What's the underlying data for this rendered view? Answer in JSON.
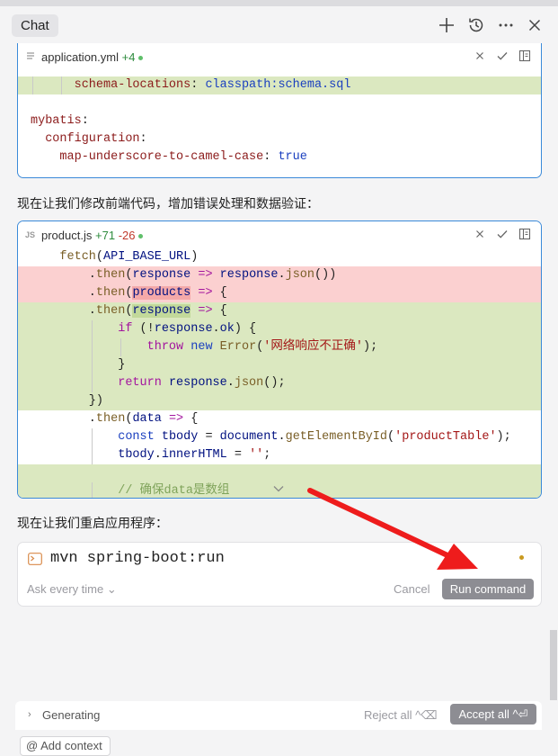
{
  "header": {
    "tab_label": "Chat",
    "icons": [
      "plus-icon",
      "history-icon",
      "more-icon",
      "close-icon"
    ]
  },
  "card1": {
    "filename": "application.yml",
    "stat_add": "+4",
    "lines": [
      {
        "t": "add",
        "parts": [
          {
            "c": "k-pl",
            "s": "      "
          },
          {
            "c": "k-key",
            "s": "schema-locations"
          },
          {
            "c": "k-pl",
            "s": ": "
          },
          {
            "c": "k-val",
            "s": "classpath:schema.sql"
          }
        ]
      },
      {
        "t": "blank",
        "parts": []
      },
      {
        "t": "plain",
        "parts": [
          {
            "c": "k-key",
            "s": "mybatis"
          },
          {
            "c": "k-pl",
            "s": ":"
          }
        ]
      },
      {
        "t": "plain",
        "parts": [
          {
            "c": "k-pl",
            "s": "  "
          },
          {
            "c": "k-key",
            "s": "configuration"
          },
          {
            "c": "k-pl",
            "s": ":"
          }
        ]
      },
      {
        "t": "plain",
        "parts": [
          {
            "c": "k-pl",
            "s": "    "
          },
          {
            "c": "k-key",
            "s": "map-underscore-to-camel-case"
          },
          {
            "c": "k-pl",
            "s": ": "
          },
          {
            "c": "k-val",
            "s": "true"
          }
        ]
      }
    ]
  },
  "para1": "现在让我们修改前端代码，增加错误处理和数据验证：",
  "card2": {
    "filename": "product.js",
    "stat_add": "+71",
    "stat_del": "-26",
    "lines": [
      {
        "t": "plain",
        "parts": [
          {
            "c": "k-pl",
            "s": "    "
          },
          {
            "c": "k-fn",
            "s": "fetch"
          },
          {
            "c": "k-pl",
            "s": "("
          },
          {
            "c": "k-id",
            "s": "API_BASE_URL"
          },
          {
            "c": "k-pl",
            "s": ")"
          }
        ]
      },
      {
        "t": "del",
        "parts": [
          {
            "c": "k-pl",
            "s": "        ."
          },
          {
            "c": "k-fn",
            "s": "then"
          },
          {
            "c": "k-pl",
            "s": "("
          },
          {
            "c": "k-id",
            "s": "response"
          },
          {
            "c": "k-pl",
            "s": " "
          },
          {
            "c": "k-kw",
            "s": "=>"
          },
          {
            "c": "k-pl",
            "s": " "
          },
          {
            "c": "k-id",
            "s": "response"
          },
          {
            "c": "k-pl",
            "s": "."
          },
          {
            "c": "k-fn",
            "s": "json"
          },
          {
            "c": "k-pl",
            "s": "())"
          }
        ]
      },
      {
        "t": "del",
        "parts": [
          {
            "c": "k-pl",
            "s": "        ."
          },
          {
            "c": "k-fn",
            "s": "then"
          },
          {
            "c": "k-pl",
            "s": "("
          },
          {
            "c": "k-id hl-del",
            "s": "products"
          },
          {
            "c": "k-pl",
            "s": " "
          },
          {
            "c": "k-kw",
            "s": "=>"
          },
          {
            "c": "k-pl",
            "s": " {"
          }
        ]
      },
      {
        "t": "add",
        "parts": [
          {
            "c": "k-pl",
            "s": "        ."
          },
          {
            "c": "k-fn",
            "s": "then"
          },
          {
            "c": "k-pl",
            "s": "("
          },
          {
            "c": "k-id hl-add",
            "s": "response"
          },
          {
            "c": "k-pl",
            "s": " "
          },
          {
            "c": "k-kw",
            "s": "=>"
          },
          {
            "c": "k-pl",
            "s": " {"
          }
        ]
      },
      {
        "t": "add",
        "parts": [
          {
            "c": "k-pl",
            "s": "            "
          },
          {
            "c": "k-kw",
            "s": "if"
          },
          {
            "c": "k-pl",
            "s": " (!"
          },
          {
            "c": "k-id",
            "s": "response"
          },
          {
            "c": "k-pl",
            "s": "."
          },
          {
            "c": "k-id",
            "s": "ok"
          },
          {
            "c": "k-pl",
            "s": ") {"
          }
        ]
      },
      {
        "t": "add",
        "parts": [
          {
            "c": "k-pl",
            "s": "                "
          },
          {
            "c": "k-kw",
            "s": "throw"
          },
          {
            "c": "k-pl",
            "s": " "
          },
          {
            "c": "k-val",
            "s": "new"
          },
          {
            "c": "k-pl",
            "s": " "
          },
          {
            "c": "k-fn",
            "s": "Error"
          },
          {
            "c": "k-pl",
            "s": "("
          },
          {
            "c": "k-str",
            "s": "'网络响应不正确'"
          },
          {
            "c": "k-pl",
            "s": ");"
          }
        ]
      },
      {
        "t": "add",
        "parts": [
          {
            "c": "k-pl",
            "s": "            }"
          }
        ]
      },
      {
        "t": "add",
        "parts": [
          {
            "c": "k-pl",
            "s": "            "
          },
          {
            "c": "k-kw",
            "s": "return"
          },
          {
            "c": "k-pl",
            "s": " "
          },
          {
            "c": "k-id",
            "s": "response"
          },
          {
            "c": "k-pl",
            "s": "."
          },
          {
            "c": "k-fn",
            "s": "json"
          },
          {
            "c": "k-pl",
            "s": "();"
          }
        ]
      },
      {
        "t": "add",
        "parts": [
          {
            "c": "k-pl",
            "s": "        })"
          }
        ]
      },
      {
        "t": "plain",
        "parts": [
          {
            "c": "k-pl",
            "s": "        ."
          },
          {
            "c": "k-fn",
            "s": "then"
          },
          {
            "c": "k-pl",
            "s": "("
          },
          {
            "c": "k-id",
            "s": "data"
          },
          {
            "c": "k-pl",
            "s": " "
          },
          {
            "c": "k-kw",
            "s": "=>"
          },
          {
            "c": "k-pl",
            "s": " {"
          }
        ]
      },
      {
        "t": "plain",
        "parts": [
          {
            "c": "k-pl",
            "s": "            "
          },
          {
            "c": "k-val",
            "s": "const"
          },
          {
            "c": "k-pl",
            "s": " "
          },
          {
            "c": "k-id",
            "s": "tbody"
          },
          {
            "c": "k-pl",
            "s": " = "
          },
          {
            "c": "k-id",
            "s": "document"
          },
          {
            "c": "k-pl",
            "s": "."
          },
          {
            "c": "k-fn",
            "s": "getElementById"
          },
          {
            "c": "k-pl",
            "s": "("
          },
          {
            "c": "k-str",
            "s": "'productTable'"
          },
          {
            "c": "k-pl",
            "s": ");"
          }
        ]
      },
      {
        "t": "plain",
        "parts": [
          {
            "c": "k-pl",
            "s": "            "
          },
          {
            "c": "k-id",
            "s": "tbody"
          },
          {
            "c": "k-pl",
            "s": "."
          },
          {
            "c": "k-id",
            "s": "innerHTML"
          },
          {
            "c": "k-pl",
            "s": " = "
          },
          {
            "c": "k-str",
            "s": "''"
          },
          {
            "c": "k-pl",
            "s": ";"
          }
        ]
      },
      {
        "t": "add",
        "parts": []
      },
      {
        "t": "add",
        "parts": [
          {
            "c": "k-pl",
            "s": "            "
          },
          {
            "c": "k-cm",
            "s": "// 确保data是数组"
          }
        ]
      }
    ]
  },
  "para2": "现在让我们重启应用程序：",
  "command": {
    "text": "mvn spring-boot:run",
    "ask_label": "Ask every time",
    "cancel_label": "Cancel",
    "run_label": "Run command"
  },
  "bottom": {
    "generating": "Generating",
    "reject_label": "Reject all ^⌫",
    "accept_label": "Accept all ^⏎",
    "context_label": "Add context"
  },
  "colors": {
    "accent_border": "#3b8ad9",
    "added_line": "#dbe8c0",
    "removed_line": "#fbd0d0",
    "annotation_arrow": "#ee1c1c"
  }
}
